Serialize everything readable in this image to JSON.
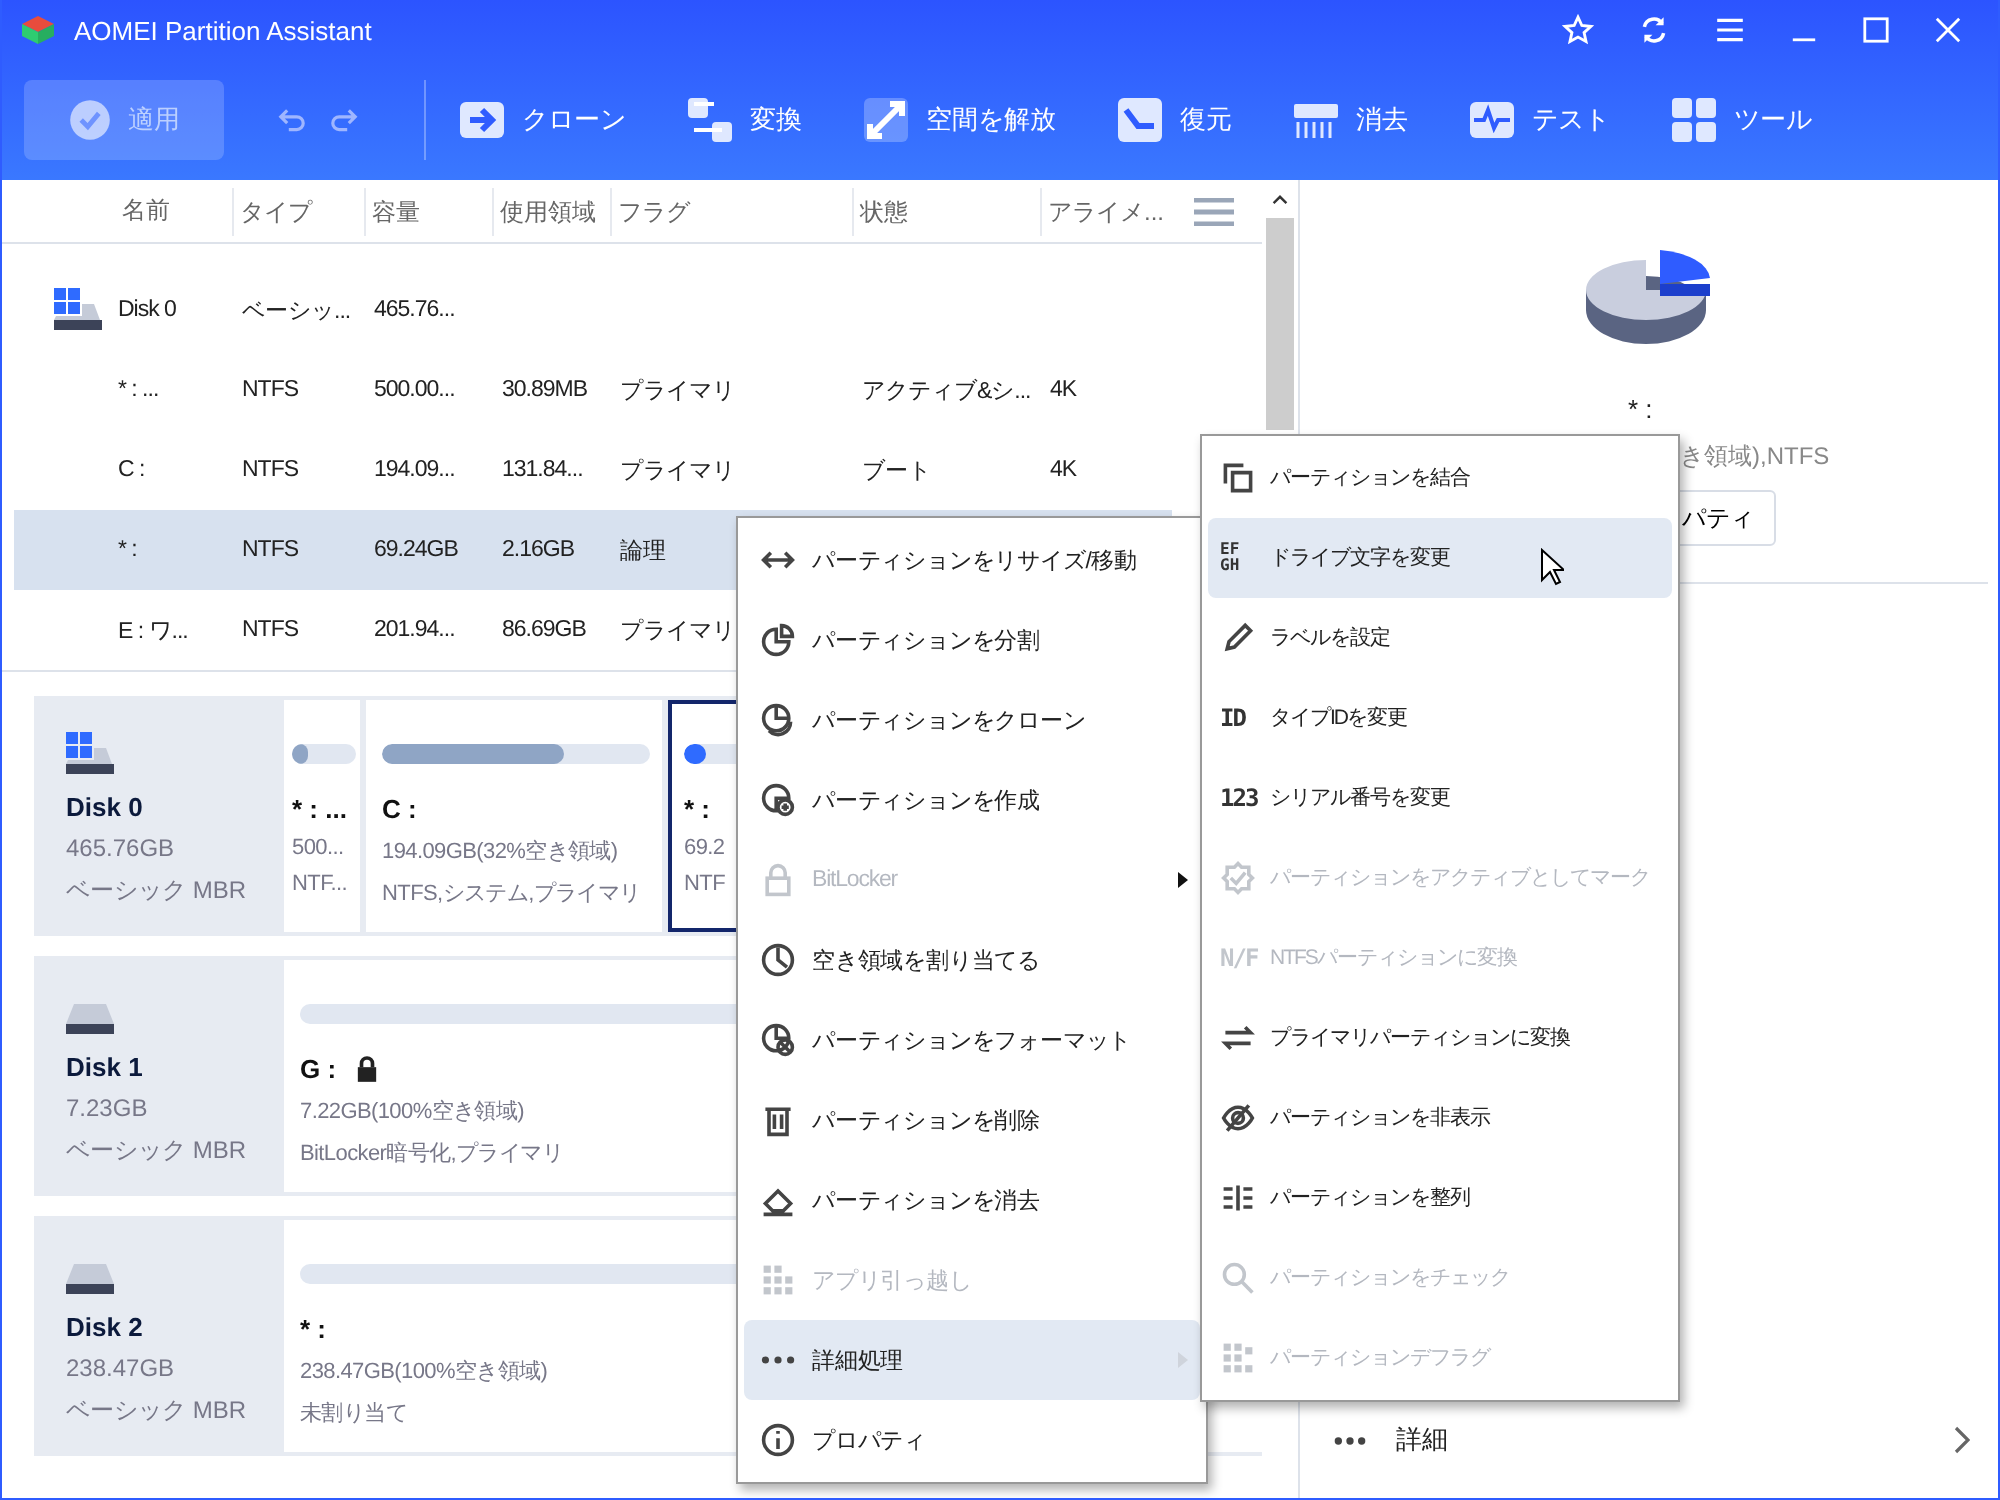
{
  "window": {
    "title": "AOMEI Partition Assistant"
  },
  "toolbar": {
    "apply": {
      "label": "適用",
      "disabled": true
    },
    "items": [
      {
        "label": "クローン"
      },
      {
        "label": "変換"
      },
      {
        "label": "空間を解放"
      },
      {
        "label": "復元"
      },
      {
        "label": "消去"
      },
      {
        "label": "テスト"
      },
      {
        "label": "ツール"
      }
    ]
  },
  "table": {
    "columns": [
      "名前",
      "タイプ",
      "容量",
      "使用領域",
      "フラグ",
      "状態",
      "アライメ..."
    ],
    "rows": [
      {
        "kind": "disk",
        "selected": false,
        "cells": [
          "Disk 0",
          "ベーシッ...",
          "465.76...",
          "",
          "",
          "",
          ""
        ]
      },
      {
        "kind": "partition",
        "selected": false,
        "cells": [
          "* : ...",
          "NTFS",
          "500.00...",
          "30.89MB",
          "プライマリ",
          "アクティブ&シ...",
          "4K"
        ]
      },
      {
        "kind": "partition",
        "selected": false,
        "cells": [
          "C :",
          "NTFS",
          "194.09...",
          "131.84...",
          "プライマリ",
          "ブート",
          "4K"
        ]
      },
      {
        "kind": "partition",
        "selected": true,
        "cells": [
          "* :",
          "NTFS",
          "69.24GB",
          "2.16GB",
          "論理"
        ]
      },
      {
        "kind": "partition",
        "selected": false,
        "cells": [
          "E : ワ...",
          "NTFS",
          "201.94...",
          "86.69GB",
          "プライマリ"
        ]
      }
    ]
  },
  "disk_map": [
    {
      "name": "Disk 0",
      "size": "465.76GB",
      "type": "ベーシック MBR",
      "windows": true,
      "partitions": [
        {
          "label": "* : ...",
          "lines": [
            "500...",
            "NTF..."
          ],
          "level": 0.25,
          "selected": false,
          "locked": false
        },
        {
          "label": "C :",
          "lines": [
            "194.09GB(32%空き領域)",
            "NTFS,システム,プライマリ"
          ],
          "level": 0.68,
          "selected": false,
          "locked": false
        },
        {
          "label": "* :",
          "lines": [
            "69.2",
            "NTF"
          ],
          "level": 0.04,
          "selected": true,
          "locked": false
        }
      ]
    },
    {
      "name": "Disk 1",
      "size": "7.23GB",
      "type": "ベーシック MBR",
      "windows": false,
      "partitions": [
        {
          "label": "G :",
          "lines": [
            "7.22GB(100%空き領域)",
            "BitLocker暗号化,プライマリ"
          ],
          "level": 0,
          "selected": false,
          "locked": true
        }
      ]
    },
    {
      "name": "Disk 2",
      "size": "238.47GB",
      "type": "ベーシック MBR",
      "windows": false,
      "partitions": [
        {
          "label": "* :",
          "lines": [
            "238.47GB(100%空き領域)",
            "未割り当て"
          ],
          "level": 0,
          "selected": false,
          "locked": false
        }
      ]
    }
  ],
  "details": {
    "name": "* :",
    "info": "き領域),NTFS",
    "button": "パティ",
    "more": "詳細"
  },
  "context_menu": [
    {
      "label": "パーティションをリサイズ/移動",
      "disabled": false,
      "selected": false,
      "submenu": false
    },
    {
      "label": "パーティションを分割",
      "disabled": false,
      "selected": false,
      "submenu": false
    },
    {
      "label": "パーティションをクローン",
      "disabled": false,
      "selected": false,
      "submenu": false
    },
    {
      "label": "パーティションを作成",
      "disabled": false,
      "selected": false,
      "submenu": false
    },
    {
      "label": "BitLocker",
      "disabled": true,
      "selected": false,
      "submenu": true
    },
    {
      "label": "空き領域を割り当てる",
      "disabled": false,
      "selected": false,
      "submenu": false
    },
    {
      "label": "パーティションをフォーマット",
      "disabled": false,
      "selected": false,
      "submenu": false
    },
    {
      "label": "パーティションを削除",
      "disabled": false,
      "selected": false,
      "submenu": false
    },
    {
      "label": "パーティションを消去",
      "disabled": false,
      "selected": false,
      "submenu": false
    },
    {
      "label": "アプリ引っ越し",
      "disabled": true,
      "selected": false,
      "submenu": false
    },
    {
      "label": "詳細処理",
      "disabled": false,
      "selected": true,
      "submenu": true
    },
    {
      "label": "プロパティ",
      "disabled": false,
      "selected": false,
      "submenu": false
    }
  ],
  "submenu": [
    {
      "label": "パーティションを結合",
      "disabled": false,
      "selected": false
    },
    {
      "label": "ドライブ文字を変更",
      "disabled": false,
      "selected": true,
      "icon_text": "EF GH"
    },
    {
      "label": "ラベルを設定",
      "disabled": false,
      "selected": false
    },
    {
      "label": "タイプIDを変更",
      "disabled": false,
      "selected": false,
      "icon_text": "ID"
    },
    {
      "label": "シリアル番号を変更",
      "disabled": false,
      "selected": false,
      "icon_text": "123"
    },
    {
      "label": "パーティションをアクティブとしてマーク",
      "disabled": true,
      "selected": false
    },
    {
      "label": "NTFSパーティションに変換",
      "disabled": true,
      "selected": false,
      "icon_text": "N/F"
    },
    {
      "label": "プライマリパーティションに変換",
      "disabled": false,
      "selected": false
    },
    {
      "label": "パーティションを非表示",
      "disabled": false,
      "selected": false
    },
    {
      "label": "パーティションを整列",
      "disabled": false,
      "selected": false
    },
    {
      "label": "パーティションをチェック",
      "disabled": true,
      "selected": false
    },
    {
      "label": "パーティションデフラグ",
      "disabled": true,
      "selected": false
    }
  ]
}
